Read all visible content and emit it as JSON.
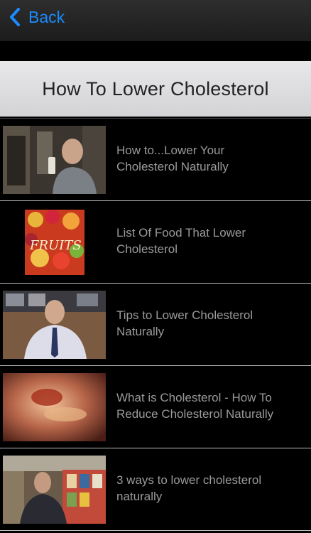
{
  "nav": {
    "back_label": "Back",
    "back_icon": "chevron-left-icon",
    "accent_color": "#1a8cff"
  },
  "header": {
    "title": "How To Lower Cholesterol"
  },
  "videos": [
    {
      "title": "How to...Lower Your\nCholesterol Naturally",
      "thumb_icon": "video-thumbnail"
    },
    {
      "title": "List Of Food That Lower\nCholesterol",
      "thumb_icon": "video-thumbnail"
    },
    {
      "title": "Tips to Lower Cholesterol\nNaturally",
      "thumb_icon": "video-thumbnail"
    },
    {
      "title": "What is Cholesterol - How To\nReduce Cholesterol Naturally",
      "thumb_icon": "video-thumbnail"
    },
    {
      "title": "3 ways to lower cholesterol\nnaturally",
      "thumb_icon": "video-thumbnail"
    }
  ]
}
